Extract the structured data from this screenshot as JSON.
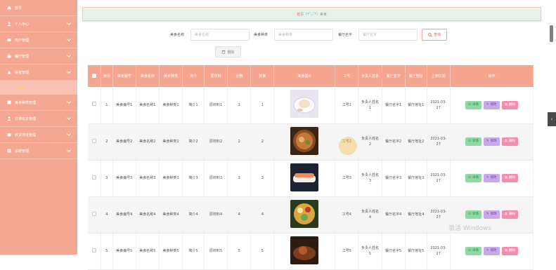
{
  "sidebar": {
    "items": [
      {
        "label": "首页",
        "icon": "home-icon",
        "chevron": false
      },
      {
        "label": "个人中心",
        "icon": "user-icon",
        "chevron": true
      },
      {
        "label": "用户管理",
        "icon": "users-icon",
        "chevron": true
      },
      {
        "label": "餐厅管理",
        "icon": "shop-icon",
        "chevron": true
      },
      {
        "label": "美食管理",
        "icon": "food-icon",
        "chevron": true,
        "expanded": true,
        "sub": "美食"
      },
      {
        "label": "美食种类管理",
        "icon": "category-icon",
        "chevron": true
      },
      {
        "label": "订单信息管理",
        "icon": "order-icon",
        "chevron": true
      },
      {
        "label": "收货地址管理",
        "icon": "address-icon",
        "chevron": true
      },
      {
        "label": "系统管理",
        "icon": "system-icon",
        "chevron": true
      }
    ]
  },
  "breadcrumb": {
    "home": "首页",
    "emoticon": "(•'◡'•)",
    "current": "美食"
  },
  "search": {
    "name_label": "美食名称",
    "name_placeholder": "美食名称",
    "type_label": "美食种类",
    "type_placeholder": "美食种类",
    "shop_label": "餐厅名字",
    "shop_placeholder": "餐厅名字",
    "search_button": "查询"
  },
  "toolbar": {
    "delete_label": "删除"
  },
  "table": {
    "headers": [
      "",
      "索引",
      "美食编号",
      "美食名称",
      "美食种类",
      "简介",
      "原材料",
      "价格",
      "数量",
      "美食图片",
      "工号",
      "负责人姓名",
      "餐厅名字",
      "餐厅地址",
      "上架日期",
      "操作"
    ],
    "rows": [
      {
        "index": "1",
        "code": "美食编号1",
        "name": "美食名称1",
        "type": "美食种类1",
        "intro": "简介1",
        "material": "原材料1",
        "price": "1",
        "qty": "1",
        "img": "dumpling",
        "emp": "工号1",
        "owner": "负责人姓名1",
        "shop": "餐厅名字1",
        "addr": "餐厅地址1",
        "date": "2021-03-27"
      },
      {
        "index": "2",
        "code": "美食编号2",
        "name": "美食名称2",
        "type": "美食种类2",
        "intro": "简介2",
        "material": "原材料2",
        "price": "2",
        "qty": "2",
        "img": "noodle",
        "emp": "工号2",
        "owner": "负责人姓名2",
        "shop": "餐厅名字2",
        "addr": "餐厅地址2",
        "date": "2021-03-27"
      },
      {
        "index": "3",
        "code": "美食编号3",
        "name": "美食名称3",
        "type": "美食种类3",
        "intro": "简介3",
        "material": "原材料3",
        "price": "3",
        "qty": "3",
        "img": "sushi",
        "emp": "工号3",
        "owner": "负责人姓名3",
        "shop": "餐厅名字3",
        "addr": "餐厅地址3",
        "date": "2021-03-27"
      },
      {
        "index": "4",
        "code": "美食编号4",
        "name": "美食名称4",
        "type": "美食种类4",
        "intro": "简介4",
        "material": "原材料4",
        "price": "4",
        "qty": "4",
        "img": "bowl",
        "emp": "工号4",
        "owner": "负责人姓名4",
        "shop": "餐厅名字4",
        "addr": "餐厅地址4",
        "date": "2021-03-27"
      },
      {
        "index": "5",
        "code": "美食编号5",
        "name": "美食名称5",
        "type": "美食种类5",
        "intro": "简介5",
        "material": "原材料5",
        "price": "5",
        "qty": "5",
        "img": "plate",
        "emp": "工号5",
        "owner": "负责人姓名5",
        "shop": "餐厅名字5",
        "addr": "餐厅地址5",
        "date": "2021-03-27"
      }
    ],
    "actions": {
      "view": "详情",
      "edit": "修改",
      "delete": "删除"
    }
  },
  "watermark": "激活 Windows",
  "colors": {
    "sidebar": "#f4a893",
    "header": "#f8a58f",
    "view": "#8fd9a5",
    "edit": "#c9a9e9",
    "delete": "#f38dad"
  }
}
